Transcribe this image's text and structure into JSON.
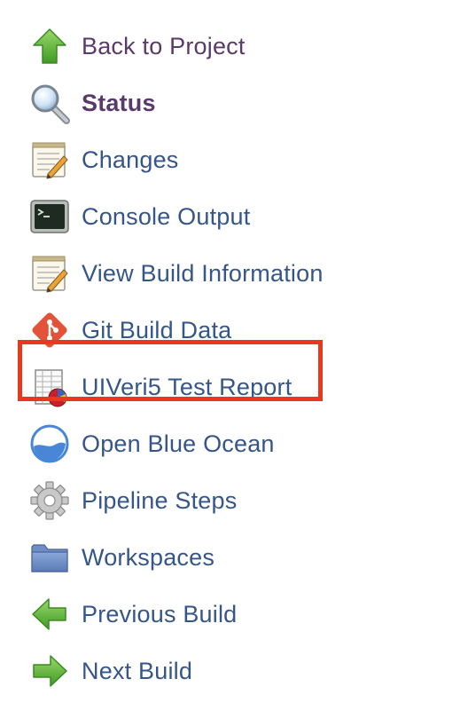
{
  "sidebar": {
    "items": [
      {
        "label": "Back to Project",
        "icon": "up-arrow-icon"
      },
      {
        "label": "Status",
        "icon": "magnifier-icon"
      },
      {
        "label": "Changes",
        "icon": "notepad-icon"
      },
      {
        "label": "Console Output",
        "icon": "terminal-icon"
      },
      {
        "label": "View Build Information",
        "icon": "notepad-icon"
      },
      {
        "label": "Git Build Data",
        "icon": "git-icon"
      },
      {
        "label": "UIVeri5 Test Report",
        "icon": "report-icon"
      },
      {
        "label": "Open Blue Ocean",
        "icon": "blue-ocean-icon"
      },
      {
        "label": "Pipeline Steps",
        "icon": "gear-icon"
      },
      {
        "label": "Workspaces",
        "icon": "folder-icon"
      },
      {
        "label": "Previous Build",
        "icon": "left-arrow-icon"
      },
      {
        "label": "Next Build",
        "icon": "right-arrow-icon"
      }
    ],
    "highlighted_item": "UIVeri5 Test Report",
    "highlight_color": "#e8381f",
    "link_color": "#36558a",
    "visited_color": "#5a3a6b"
  }
}
